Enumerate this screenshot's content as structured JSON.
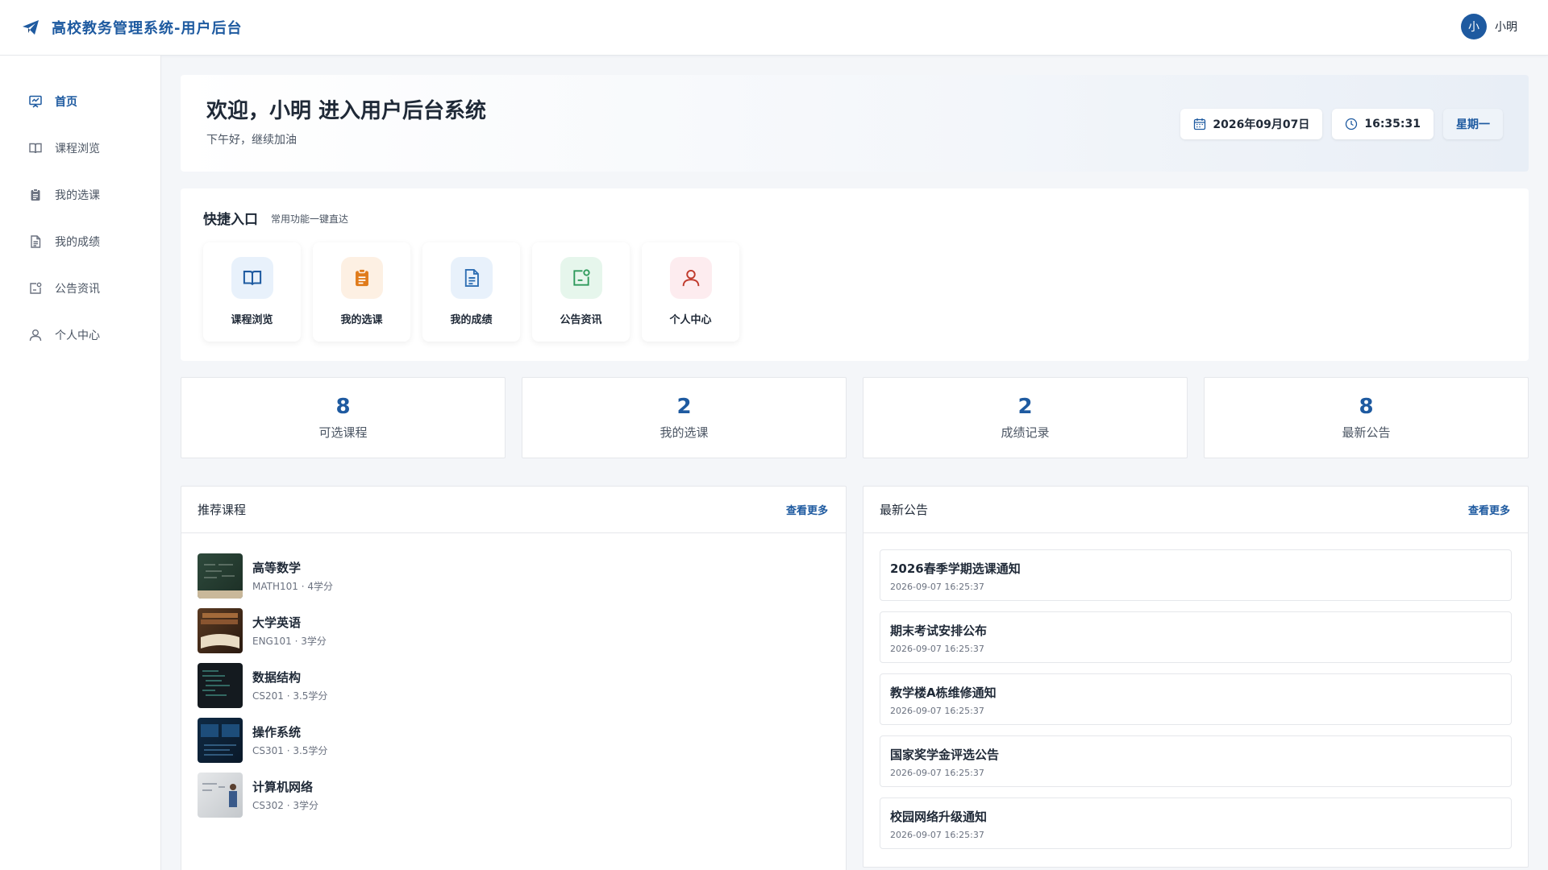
{
  "header": {
    "title": "高校教务管理系统-用户后台",
    "avatar_initial": "小",
    "user_name": "小明"
  },
  "sidebar": {
    "items": [
      {
        "label": "首页",
        "icon": "presentation-icon",
        "active": true
      },
      {
        "label": "课程浏览",
        "icon": "book-icon"
      },
      {
        "label": "我的选课",
        "icon": "clipboard-icon"
      },
      {
        "label": "我的成绩",
        "icon": "document-icon"
      },
      {
        "label": "公告资讯",
        "icon": "announcement-icon"
      },
      {
        "label": "个人中心",
        "icon": "user-icon"
      }
    ]
  },
  "welcome": {
    "title": "欢迎，小明 进入用户后台系统",
    "subtitle": "下午好，继续加油",
    "date": "2026年09月07日",
    "time": "16:35:31",
    "weekday": "星期一"
  },
  "quick": {
    "title": "快捷入口",
    "subtitle": "常用功能一键直达",
    "items": [
      {
        "label": "课程浏览",
        "icon": "book-icon",
        "color": "#1e5aa0",
        "bg": "#e8f1fb"
      },
      {
        "label": "我的选课",
        "icon": "clipboard-icon",
        "color": "#e07b1a",
        "bg": "#fdf0e3"
      },
      {
        "label": "我的成绩",
        "icon": "document-icon",
        "color": "#2f6fb3",
        "bg": "#e8f1fb"
      },
      {
        "label": "公告资讯",
        "icon": "announcement-icon",
        "color": "#2e9a5b",
        "bg": "#e6f6ec"
      },
      {
        "label": "个人中心",
        "icon": "user-icon",
        "color": "#c0392b",
        "bg": "#fdecef"
      }
    ]
  },
  "stats": [
    {
      "value": "8",
      "label": "可选课程"
    },
    {
      "value": "2",
      "label": "我的选课"
    },
    {
      "value": "2",
      "label": "成绩记录"
    },
    {
      "value": "8",
      "label": "最新公告"
    }
  ],
  "courses_panel": {
    "title": "推荐课程",
    "more": "查看更多",
    "items": [
      {
        "name": "高等数学",
        "meta": "MATH101 · 4学分"
      },
      {
        "name": "大学英语",
        "meta": "ENG101 · 3学分"
      },
      {
        "name": "数据结构",
        "meta": "CS201 · 3.5学分"
      },
      {
        "name": "操作系统",
        "meta": "CS301 · 3.5学分"
      },
      {
        "name": "计算机网络",
        "meta": "CS302 · 3学分"
      }
    ]
  },
  "notices_panel": {
    "title": "最新公告",
    "more": "查看更多",
    "items": [
      {
        "title": "2026春季学期选课通知",
        "time": "2026-09-07 16:25:37"
      },
      {
        "title": "期末考试安排公布",
        "time": "2026-09-07 16:25:37"
      },
      {
        "title": "教学楼A栋维修通知",
        "time": "2026-09-07 16:25:37"
      },
      {
        "title": "国家奖学金评选公告",
        "time": "2026-09-07 16:25:37"
      },
      {
        "title": "校园网络升级通知",
        "time": "2026-09-07 16:25:37"
      }
    ]
  },
  "colors": {
    "primary": "#1e5aa0",
    "background": "#f4f6f9"
  }
}
